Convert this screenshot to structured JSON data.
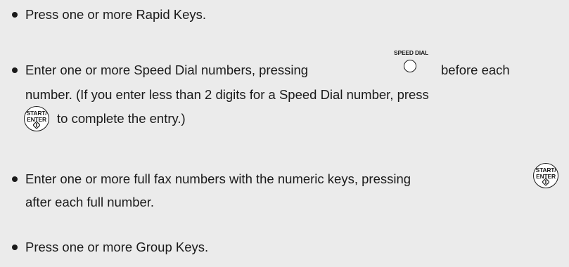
{
  "items": [
    {
      "text": "Press one or more Rapid Keys."
    },
    {
      "text_part1": "Enter one or more Speed Dial numbers, pressing",
      "text_part2": "before each",
      "line2": "number. (If you enter less than 2 digits for a Speed Dial number, press",
      "line3": "to complete the entry.)"
    },
    {
      "text_part1": "Enter one or more full fax numbers with the numeric keys, pressing",
      "line2": "after each full number."
    },
    {
      "text": "Press one or more Group Keys."
    }
  ],
  "icons": {
    "speed_dial_label": "SPEED DIAL",
    "start_label_top": "START/",
    "start_label_bottom": "ENTER"
  }
}
